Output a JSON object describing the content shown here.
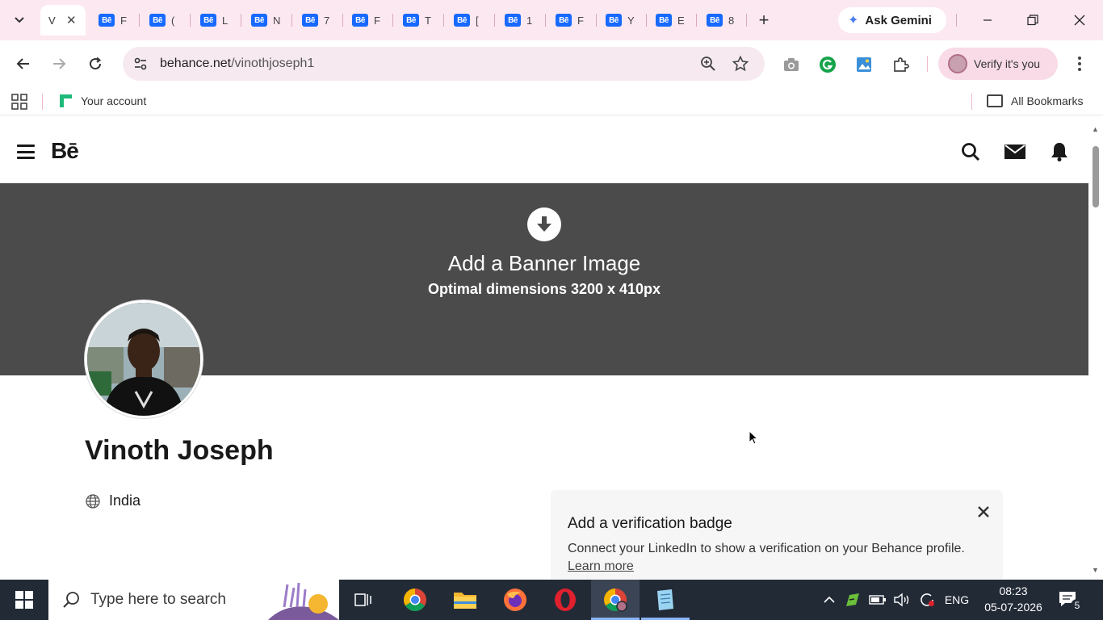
{
  "browser": {
    "tabs": [
      {
        "title": "V",
        "active": true
      },
      {
        "letter": "F"
      },
      {
        "letter": "("
      },
      {
        "letter": "L"
      },
      {
        "letter": "N"
      },
      {
        "letter": "7"
      },
      {
        "letter": "F"
      },
      {
        "letter": "T"
      },
      {
        "letter": "["
      },
      {
        "letter": "1"
      },
      {
        "letter": "F"
      },
      {
        "letter": "Y"
      },
      {
        "letter": "E"
      },
      {
        "letter": "8"
      }
    ],
    "favicon_text": "Bē",
    "gemini_label": "Ask Gemini",
    "url_host": "behance.net",
    "url_path": "/vinothjoseph1",
    "verify_label": "Verify it's you",
    "bookmark_your_account": "Your account",
    "bookmark_all": "All Bookmarks",
    "colors": {
      "tabbar": "#fce8f0",
      "omnibox": "#f6eaf0",
      "behance_blue": "#1769ff"
    }
  },
  "behance": {
    "logo": "Bē",
    "banner_title": "Add a Banner Image",
    "banner_subtitle": "Optimal dimensions 3200 x 410px",
    "profile_name": "Vinoth Joseph",
    "location": "India",
    "verify_card": {
      "title": "Add a verification badge",
      "text": "Connect your LinkedIn to show a verification on your Behance profile.",
      "link": "Learn more"
    }
  },
  "taskbar": {
    "search_placeholder": "Type here to search",
    "language": "ENG",
    "time": "08:23",
    "date": "05-07-2026",
    "notification_count": "5"
  }
}
